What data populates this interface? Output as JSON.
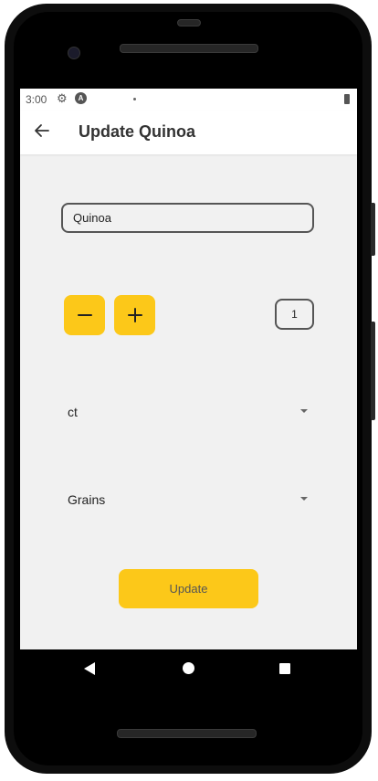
{
  "status_bar": {
    "time": "3:00",
    "badge": "A"
  },
  "app_bar": {
    "title": "Update Quinoa"
  },
  "form": {
    "name_value": "Quinoa",
    "quantity": "1",
    "unit": "ct",
    "category": "Grains",
    "update_label": "Update"
  },
  "icons": {
    "back": "arrow-left-icon",
    "minus": "minus-icon",
    "plus": "plus-icon",
    "dropdown": "caret-down-icon"
  },
  "colors": {
    "accent": "#fcc819",
    "background": "#f1f1f1"
  }
}
